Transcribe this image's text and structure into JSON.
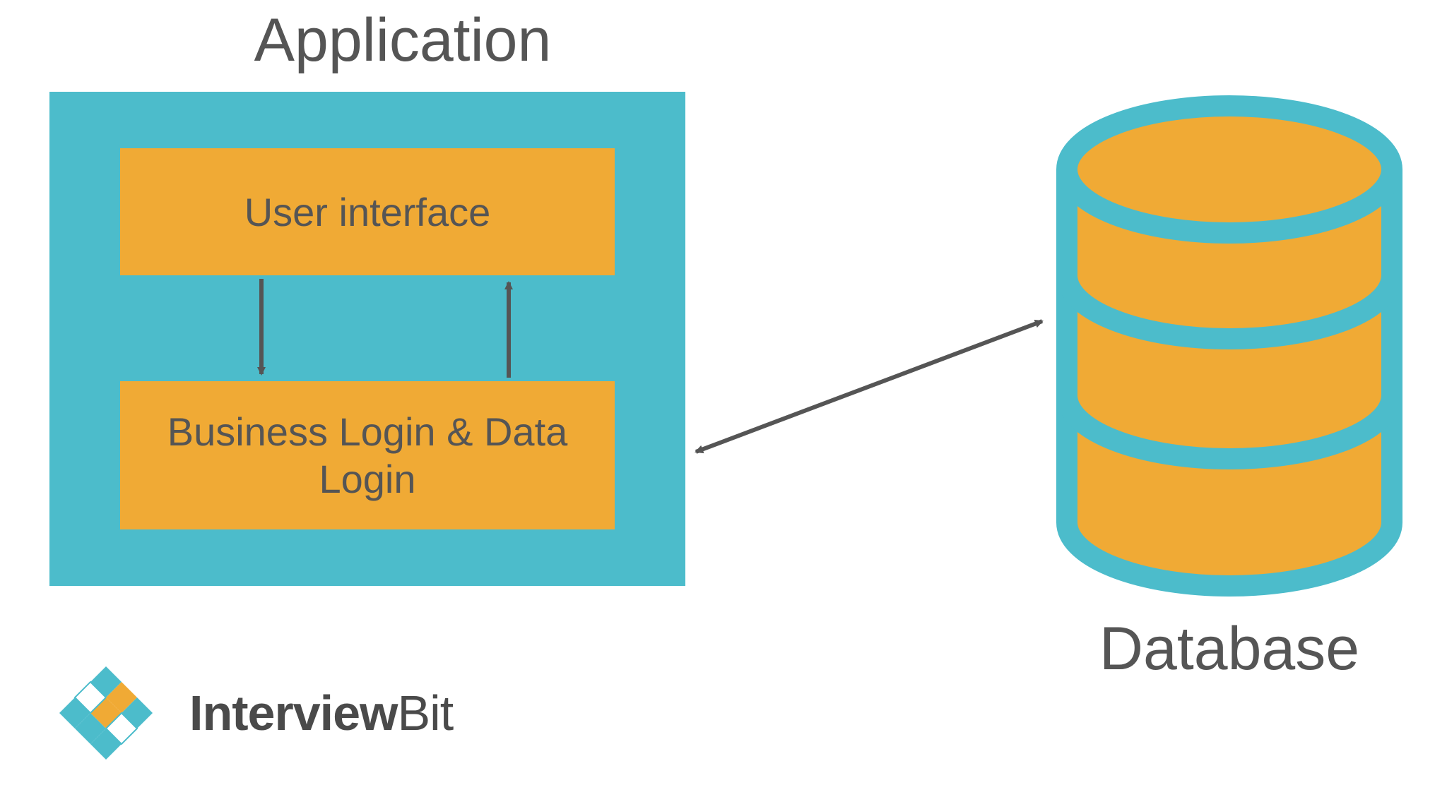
{
  "diagram": {
    "title": "Application",
    "ui_box": "User interface",
    "business_box": "Business Login & Data Login",
    "database_label": "Database"
  },
  "brand": {
    "name_bold": "Interview",
    "name_light": "Bit"
  },
  "colors": {
    "teal": "#4cbccb",
    "orange": "#f0aa35",
    "text": "#555555",
    "arrow": "#555555"
  }
}
